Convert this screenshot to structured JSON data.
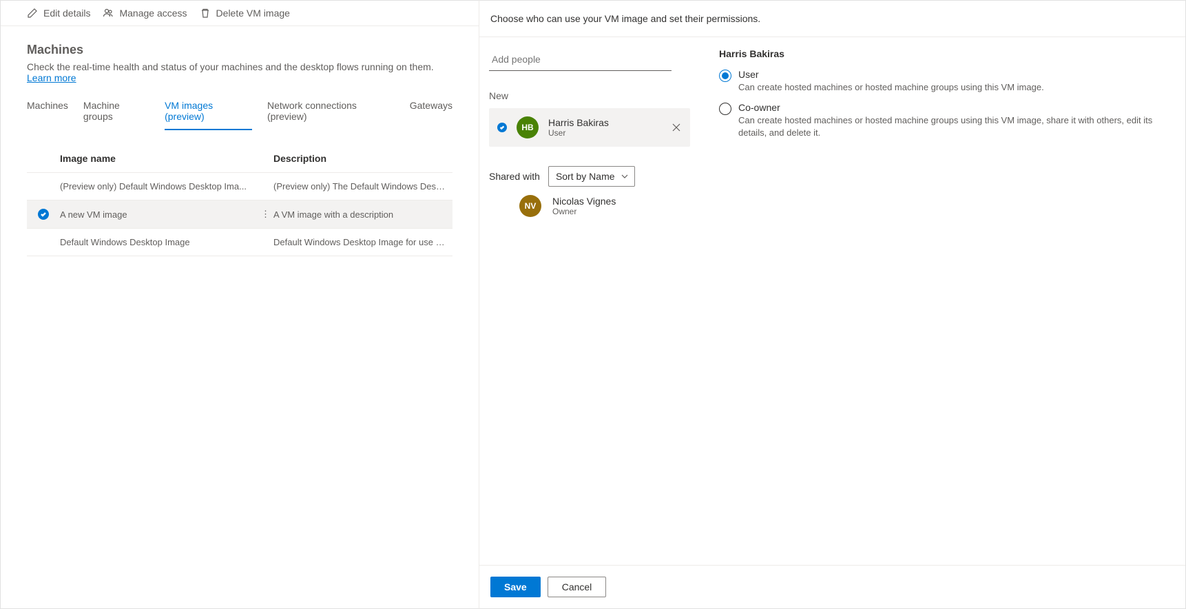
{
  "toolbar": {
    "edit_label": "Edit details",
    "manage_label": "Manage access",
    "delete_label": "Delete VM image"
  },
  "page": {
    "title": "Machines",
    "subtitle_pre": "Check the real-time health and status of your machines and the desktop flows running on them. ",
    "learn_more": "Learn more"
  },
  "tabs": [
    {
      "label": "Machines"
    },
    {
      "label": "Machine groups"
    },
    {
      "label": "VM images (preview)"
    },
    {
      "label": "Network connections (preview)"
    },
    {
      "label": "Gateways"
    }
  ],
  "table": {
    "col_name": "Image name",
    "col_desc": "Description",
    "rows": [
      {
        "name": "(Preview only) Default Windows Desktop Ima...",
        "desc": "(Preview only) The Default Windows Desktop Image for use i..."
      },
      {
        "name": "A new VM image",
        "desc": "A VM image with a description"
      },
      {
        "name": "Default Windows Desktop Image",
        "desc": "Default Windows Desktop Image for use in Microsoft Deskto..."
      }
    ]
  },
  "panel": {
    "header": "Choose who can use your VM image and set their permissions.",
    "add_placeholder": "Add people",
    "new_label": "New",
    "shared_label": "Shared with",
    "sort_value": "Sort by Name",
    "save_label": "Save",
    "cancel_label": "Cancel"
  },
  "new_person": {
    "initials": "HB",
    "name": "Harris Bakiras",
    "role": "User"
  },
  "owner": {
    "initials": "NV",
    "name": "Nicolas Vignes",
    "role": "Owner"
  },
  "permissions": {
    "title": "Harris Bakiras",
    "options": [
      {
        "label": "User",
        "desc": "Can create hosted machines or hosted machine groups using this VM image."
      },
      {
        "label": "Co-owner",
        "desc": "Can create hosted machines or hosted machine groups using this VM image, share it with others, edit its details, and delete it."
      }
    ]
  }
}
